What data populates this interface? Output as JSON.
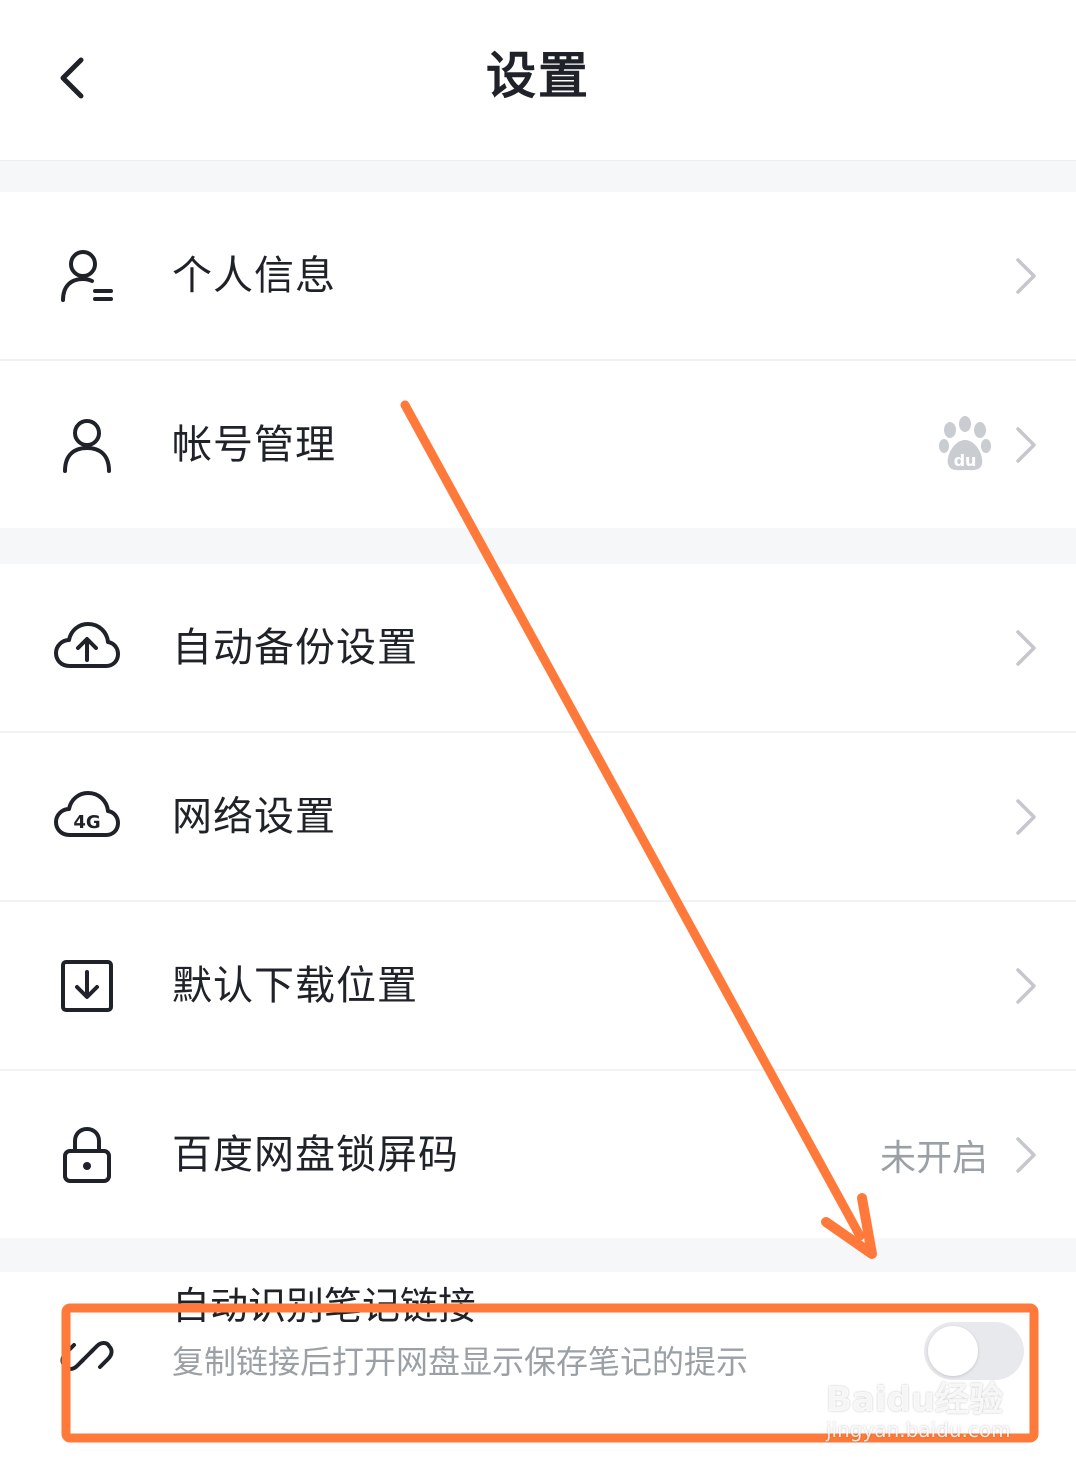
{
  "header": {
    "title": "设置"
  },
  "group1": [
    {
      "label": "个人信息",
      "icon": "person-info-icon"
    },
    {
      "label": "帐号管理",
      "icon": "person-icon",
      "badge": "du"
    }
  ],
  "group2": [
    {
      "label": "自动备份设置",
      "icon": "cloud-upload-icon"
    },
    {
      "label": "网络设置",
      "icon": "cloud-4g-icon",
      "icon_text": "4G"
    },
    {
      "label": "默认下载位置",
      "icon": "download-box-icon"
    },
    {
      "label": "百度网盘锁屏码",
      "icon": "lock-icon",
      "value": "未开启"
    }
  ],
  "toggle_item": {
    "title": "自动识别笔记链接",
    "subtitle": "复制链接后打开网盘显示保存笔记的提示",
    "icon": "link-icon"
  },
  "watermark": {
    "main": "Baidu经验",
    "sub": "jingyan.baidu.com"
  },
  "colors": {
    "annotation": "#ff7a3a",
    "chevron": "#c4c7cc",
    "text": "#1f2329",
    "secondary": "#9aa0a6"
  }
}
